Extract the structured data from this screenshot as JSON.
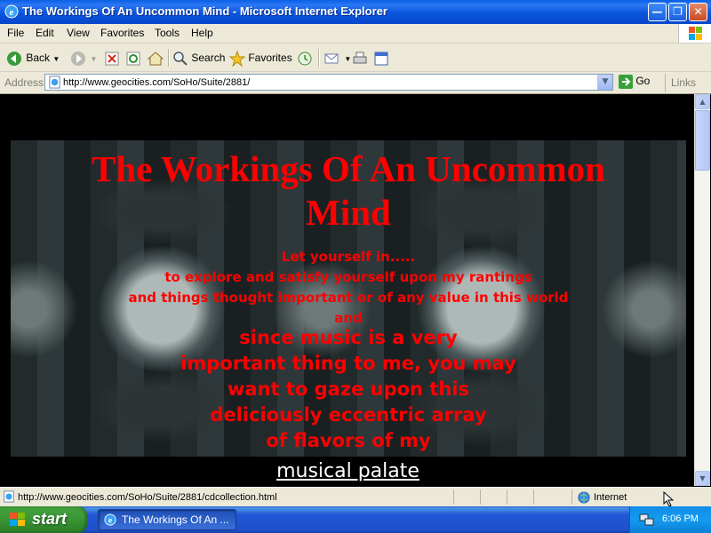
{
  "window": {
    "title": "The Workings Of An Uncommon Mind - Microsoft Internet Explorer",
    "controls": {
      "minimize": "—",
      "maximize": "❐",
      "close": "✕"
    }
  },
  "menu": [
    "File",
    "Edit",
    "View",
    "Favorites",
    "Tools",
    "Help"
  ],
  "toolbar": {
    "back_label": "Back",
    "search_label": "Search",
    "favorites_label": "Favorites"
  },
  "address": {
    "label": "Address",
    "url": "http://www.geocities.com/SoHo/Suite/2881/",
    "go_label": "Go",
    "links_label": "Links"
  },
  "page": {
    "title_line1": "The Workings Of An Uncommon",
    "title_line2": "Mind",
    "small_lines": [
      "Let yourself in.....",
      "to explore and satisfy yourself upon my rantings",
      "and things thought important or of any value in this world",
      "and"
    ],
    "big_lines": [
      "since music is a very",
      "important thing to me, you may",
      "want to gaze upon this",
      "deliciously eccentric array",
      "of flavors of my"
    ],
    "link_text": "musical palate"
  },
  "status": {
    "text": "http://www.geocities.com/SoHo/Suite/2881/cdcollection.html",
    "zone": "Internet"
  },
  "taskbar": {
    "start_label": "start",
    "task_label": "The Workings Of An ...",
    "clock": "6:06 PM"
  },
  "colors": {
    "title_bar": "#0b55de",
    "page_text": "#ff0000",
    "taskbar": "#2157d7",
    "start_button": "#3c9a37"
  }
}
